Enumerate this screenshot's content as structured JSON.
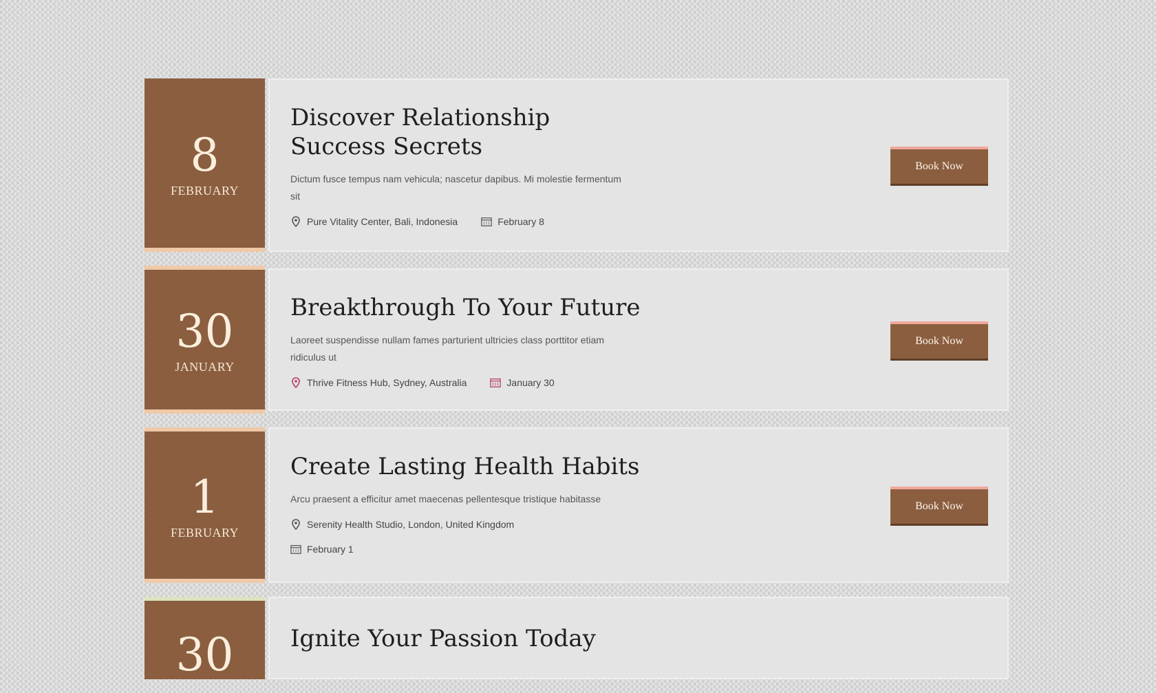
{
  "events": [
    {
      "day": "8",
      "month": "FEBRUARY",
      "title": "Discover Relationship Success Secrets",
      "description": "Dictum fusce tempus nam vehicula; nascetur dapibus. Mi molestie fermentum sit",
      "location": "Pure Vitality Center, Bali, Indonesia",
      "date_label": "February 8",
      "button_label": "Book Now"
    },
    {
      "day": "30",
      "month": "JANUARY",
      "title": "Breakthrough To Your Future",
      "description": "Laoreet suspendisse nullam fames parturient ultricies class porttitor etiam ridiculus ut",
      "location": "Thrive Fitness Hub, Sydney, Australia",
      "date_label": "January 30",
      "button_label": "Book Now"
    },
    {
      "day": "1",
      "month": "FEBRUARY",
      "title": "Create Lasting Health Habits",
      "description": "Arcu praesent a efficitur amet maecenas pellentesque tristique habitasse",
      "location": "Serenity Health Studio, London, United Kingdom",
      "date_label": "February 1",
      "button_label": "Book Now"
    },
    {
      "day": "30",
      "title": "Ignite Your Passion Today"
    }
  ],
  "icons": {
    "location": "location-pin-icon",
    "calendar": "calendar-icon"
  },
  "colors": {
    "date_box": "#8a5e3f",
    "accent": "#f0a89c",
    "card": "#e4e4e4"
  }
}
